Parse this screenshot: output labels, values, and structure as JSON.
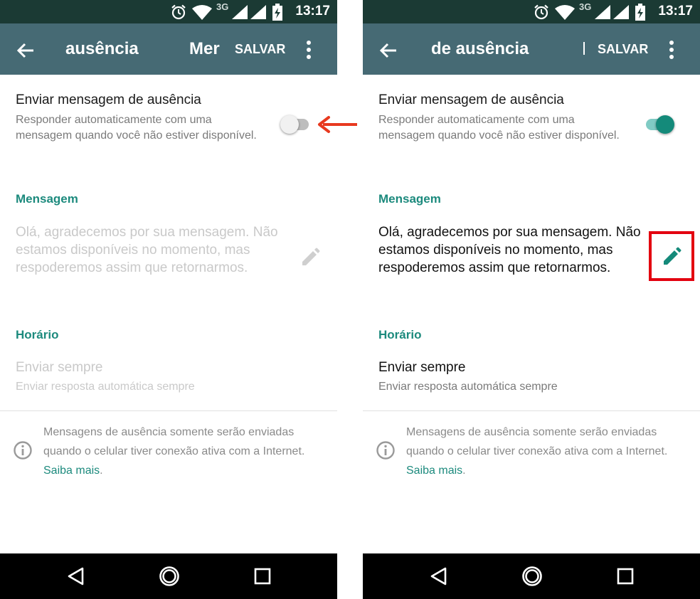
{
  "colors": {
    "status_bar": "#1b3a34",
    "toolbar": "#466a74",
    "accent_teal": "#1c8a7d",
    "toggle_on": "#148a7a",
    "highlight_red": "#e3000f",
    "arrow_red": "#e8391f",
    "nav_bar": "#000000"
  },
  "left": {
    "status": {
      "network": "3G",
      "time": "13:17",
      "icons": [
        "alarm-icon",
        "wifi-icon",
        "signal-icon",
        "signal-icon",
        "battery-charging-icon"
      ]
    },
    "toolbar": {
      "title": "ausência",
      "title_extra": "Mer",
      "save": "SALVAR",
      "back_icon": "arrow-left-icon",
      "more_icon": "more-vert-icon"
    },
    "auto_reply": {
      "title": "Enviar mensagem de ausência",
      "subtitle": "Responder automaticamente com uma mensagem quando você não estiver disponível.",
      "enabled": false
    },
    "message_section": {
      "header": "Mensagem",
      "text": "Olá, agradecemos por sua mensagem. Não estamos disponíveis no momento, mas respoderemos assim que retornarmos.",
      "edit_icon": "pencil-icon"
    },
    "schedule_section": {
      "header": "Horário",
      "option_title": "Enviar sempre",
      "option_subtitle": "Enviar resposta automática sempre"
    },
    "info": {
      "text": "Mensagens de ausência somente serão enviadas quando o celular tiver conexão ativa com a Internet.",
      "link": "Saiba mais",
      "trailing": "."
    },
    "nav": [
      "back-triangle-icon",
      "home-circle-icon",
      "recents-square-icon"
    ]
  },
  "right": {
    "status": {
      "network": "3G",
      "time": "13:17",
      "icons": [
        "alarm-icon",
        "wifi-icon",
        "signal-icon",
        "signal-icon",
        "battery-charging-icon"
      ]
    },
    "toolbar": {
      "title": "de ausência",
      "save": "SALVAR",
      "back_icon": "arrow-left-icon",
      "more_icon": "more-vert-icon"
    },
    "auto_reply": {
      "title": "Enviar mensagem de ausência",
      "subtitle": "Responder automaticamente com uma mensagem quando você não estiver disponível.",
      "enabled": true
    },
    "message_section": {
      "header": "Mensagem",
      "text": "Olá, agradecemos por sua mensagem. Não estamos disponíveis no momento, mas respoderemos assim que retornarmos.",
      "edit_icon": "pencil-icon"
    },
    "schedule_section": {
      "header": "Horário",
      "option_title": "Enviar sempre",
      "option_subtitle": "Enviar resposta automática sempre"
    },
    "info": {
      "text": "Mensagens de ausência somente serão enviadas quando o celular tiver conexão ativa com a Internet.",
      "link": "Saiba mais",
      "trailing": "."
    },
    "nav": [
      "back-triangle-icon",
      "home-circle-icon",
      "recents-square-icon"
    ]
  }
}
